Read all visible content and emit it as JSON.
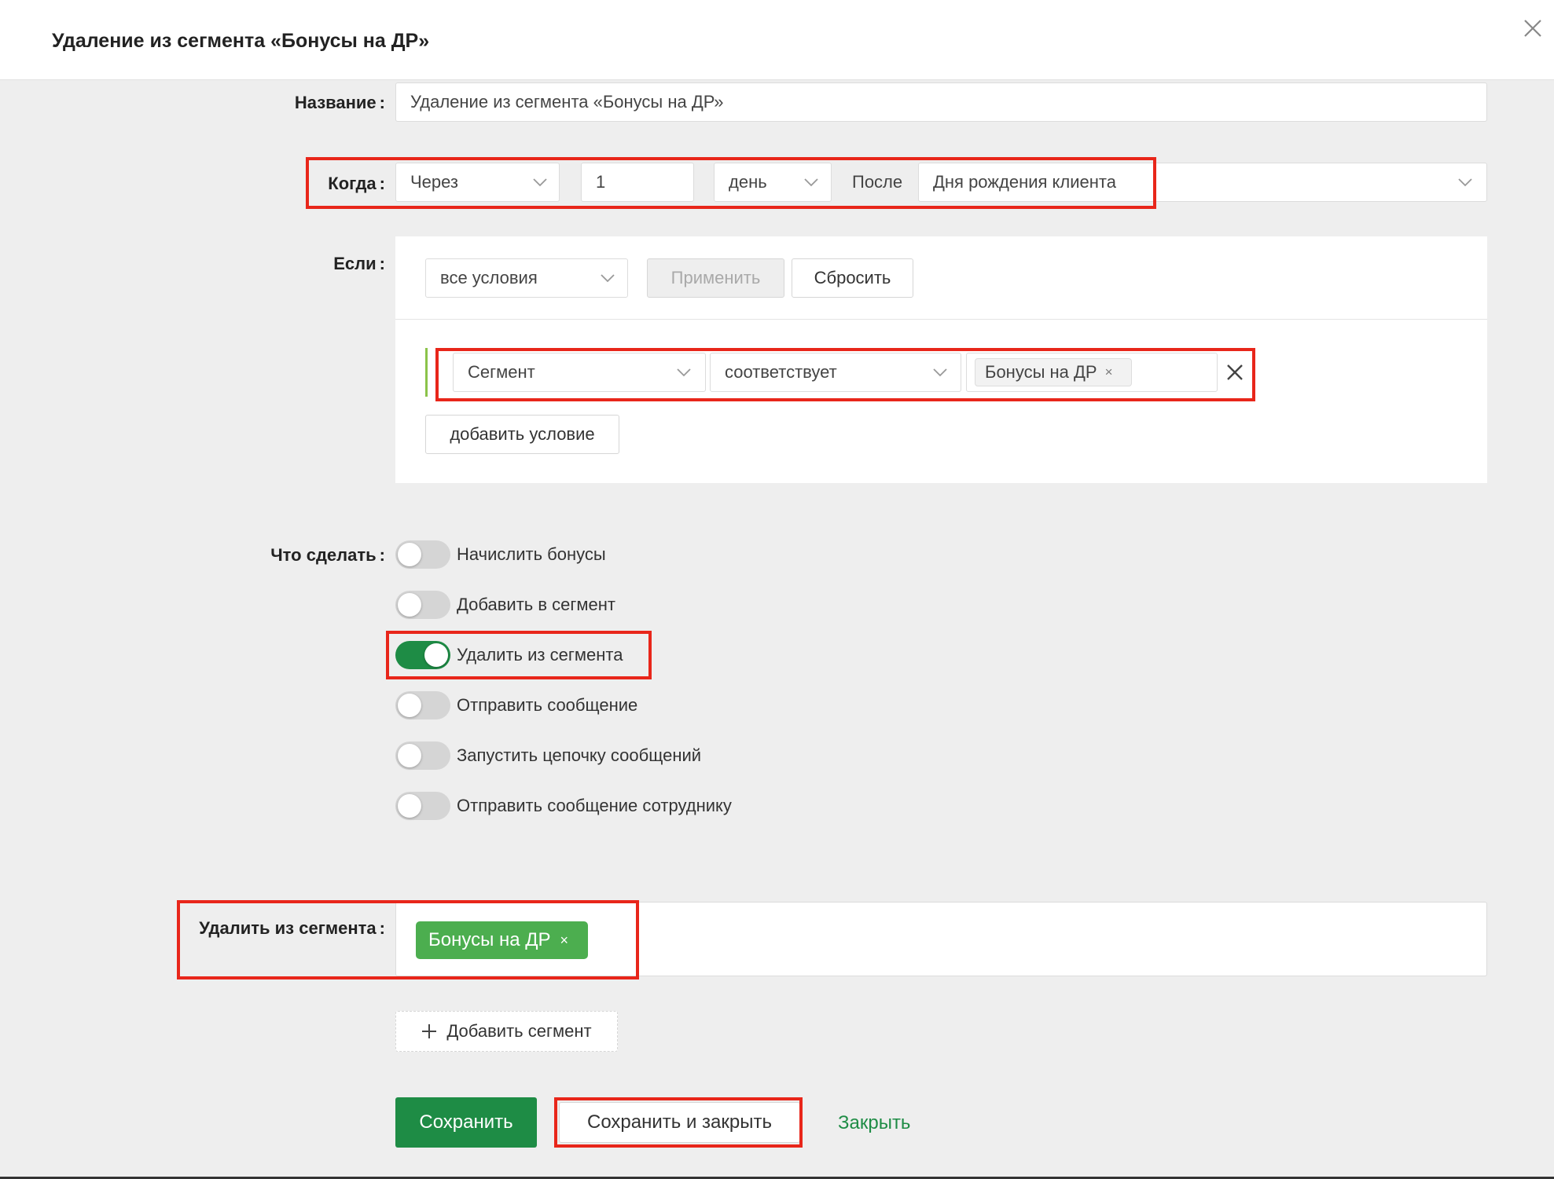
{
  "header": {
    "title": "Удаление из сегмента «Бонусы на ДР»",
    "close_icon": "close-icon"
  },
  "labels": {
    "name": "Название",
    "when": "Когда",
    "if": "Если",
    "action": "Что сделать",
    "remove_segment": "Удалить из сегмента",
    "colon": ":"
  },
  "name_field": {
    "value": "Удаление из сегмента «Бонусы на ДР»"
  },
  "when": {
    "mode": "Через",
    "amount": "1",
    "unit": "день",
    "after_label": "После",
    "event": "Дня рождения клиента"
  },
  "conditions": {
    "match": "все условия",
    "apply": "Применить",
    "reset": "Сбросить",
    "row": {
      "field": "Сегмент",
      "operator": "соответствует",
      "value_tag": "Бонусы на ДР",
      "tag_remove": "×"
    },
    "add_condition": "добавить условие"
  },
  "actions": [
    {
      "label": "Начислить бонусы",
      "on": false
    },
    {
      "label": "Добавить в сегмент",
      "on": false
    },
    {
      "label": "Удалить из сегмента",
      "on": true
    },
    {
      "label": "Отправить сообщение",
      "on": false
    },
    {
      "label": "Запустить цепочку сообщений",
      "on": false
    },
    {
      "label": "Отправить сообщение сотруднику",
      "on": false
    }
  ],
  "remove_segment": {
    "tag": "Бонусы на ДР",
    "tag_remove": "×",
    "add_button": "Добавить сегмент"
  },
  "footer": {
    "save": "Сохранить",
    "save_close": "Сохранить и закрыть",
    "close": "Закрыть"
  },
  "colors": {
    "accent": "#1e8c45",
    "highlight": "#e8261a",
    "tag_green": "#4cae4f"
  }
}
